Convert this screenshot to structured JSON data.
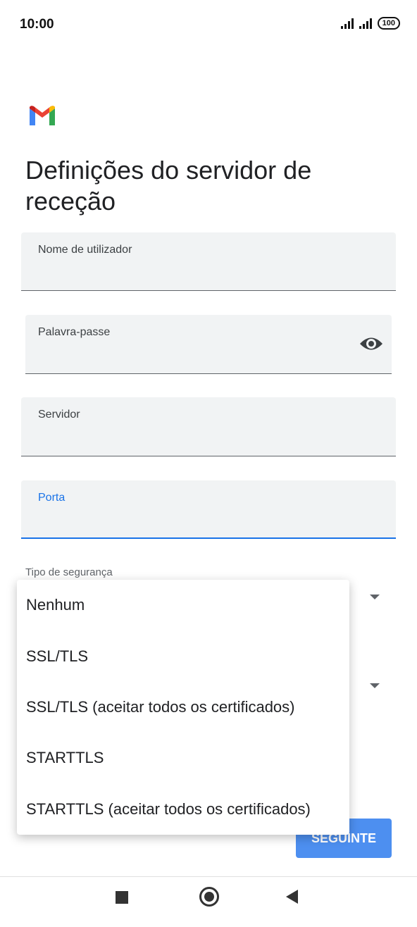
{
  "status_bar": {
    "time": "10:00",
    "battery": "100",
    "icons": [
      "signal-icon",
      "signal-icon",
      "battery-icon"
    ]
  },
  "app": {
    "logo_icon": "gmail-logo-icon",
    "brand_colors": {
      "red": "#ea4335",
      "blue": "#4285f4",
      "green": "#34a853",
      "yellow": "#fbbc04"
    }
  },
  "page": {
    "title": "Definições do servidor de receção"
  },
  "fields": {
    "username": {
      "label": "Nome de utilizador",
      "value": ""
    },
    "password": {
      "label": "Palavra-passe",
      "value": "",
      "icon": "eye-icon"
    },
    "server": {
      "label": "Servidor",
      "value": ""
    },
    "port": {
      "label": "Porta",
      "value": "",
      "focused": true
    }
  },
  "security": {
    "label": "Tipo de segurança",
    "icon": "dropdown-arrow-icon"
  },
  "dropdown_menu": {
    "items": [
      "Nenhum",
      "SSL/TLS",
      "SSL/TLS (aceitar todos os certificados)",
      "STARTTLS",
      "STARTTLS (aceitar todos os certificados)"
    ]
  },
  "actions": {
    "next_label": "SEGUINTE"
  },
  "colors": {
    "accent": "#1a73e8",
    "button": "#4d8ff0",
    "field_bg": "#f1f3f4"
  },
  "navigation": {
    "icons": [
      "recents-square-icon",
      "home-circle-icon",
      "back-triangle-icon"
    ]
  }
}
